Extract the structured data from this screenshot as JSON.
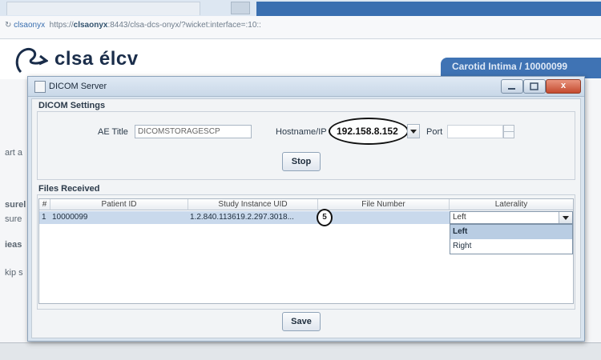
{
  "browser": {
    "address_prefix": "clsaonyx",
    "address_url_before": "https://",
    "address_url_site": "clsaonyx",
    "address_url_after": ":8443/clsa-dcs-onyx/?wicket:interface=:10::"
  },
  "page": {
    "logo_text": "clsa élcv",
    "header_tab": "Carotid Intima / 10000099",
    "side_fragments": [
      "art a",
      "surel",
      "sure",
      "ieas",
      "kip s"
    ]
  },
  "dialog": {
    "title": "DICOM Server",
    "close_label": "x"
  },
  "settings": {
    "group_label": "DICOM Settings",
    "ae_title_label": "AE Title",
    "ae_title_value": "DICOMSTORAGESCP",
    "hostname_label": "Hostname/IP",
    "hostname_value": "192.158.8.152",
    "port_label": "Port",
    "port_value": "",
    "stop_label": "Stop"
  },
  "files": {
    "group_label": "Files Received",
    "columns": [
      "#",
      "Patient ID",
      "Study Instance UID",
      "File Number",
      "Laterality"
    ],
    "rows": [
      {
        "num": "1",
        "patient_id": "10000099",
        "study_uid": "1.2.840.113619.2.297.3018...",
        "file_number": "5",
        "laterality": "Left"
      }
    ],
    "laterality_options": [
      "Left",
      "Right"
    ],
    "save_label": "Save"
  },
  "colors": {
    "dialog_bg": "#d9e4ef",
    "selected_row": "#c9d9ec",
    "header_tab": "#3f73b4",
    "close_button": "#c44a2f"
  }
}
